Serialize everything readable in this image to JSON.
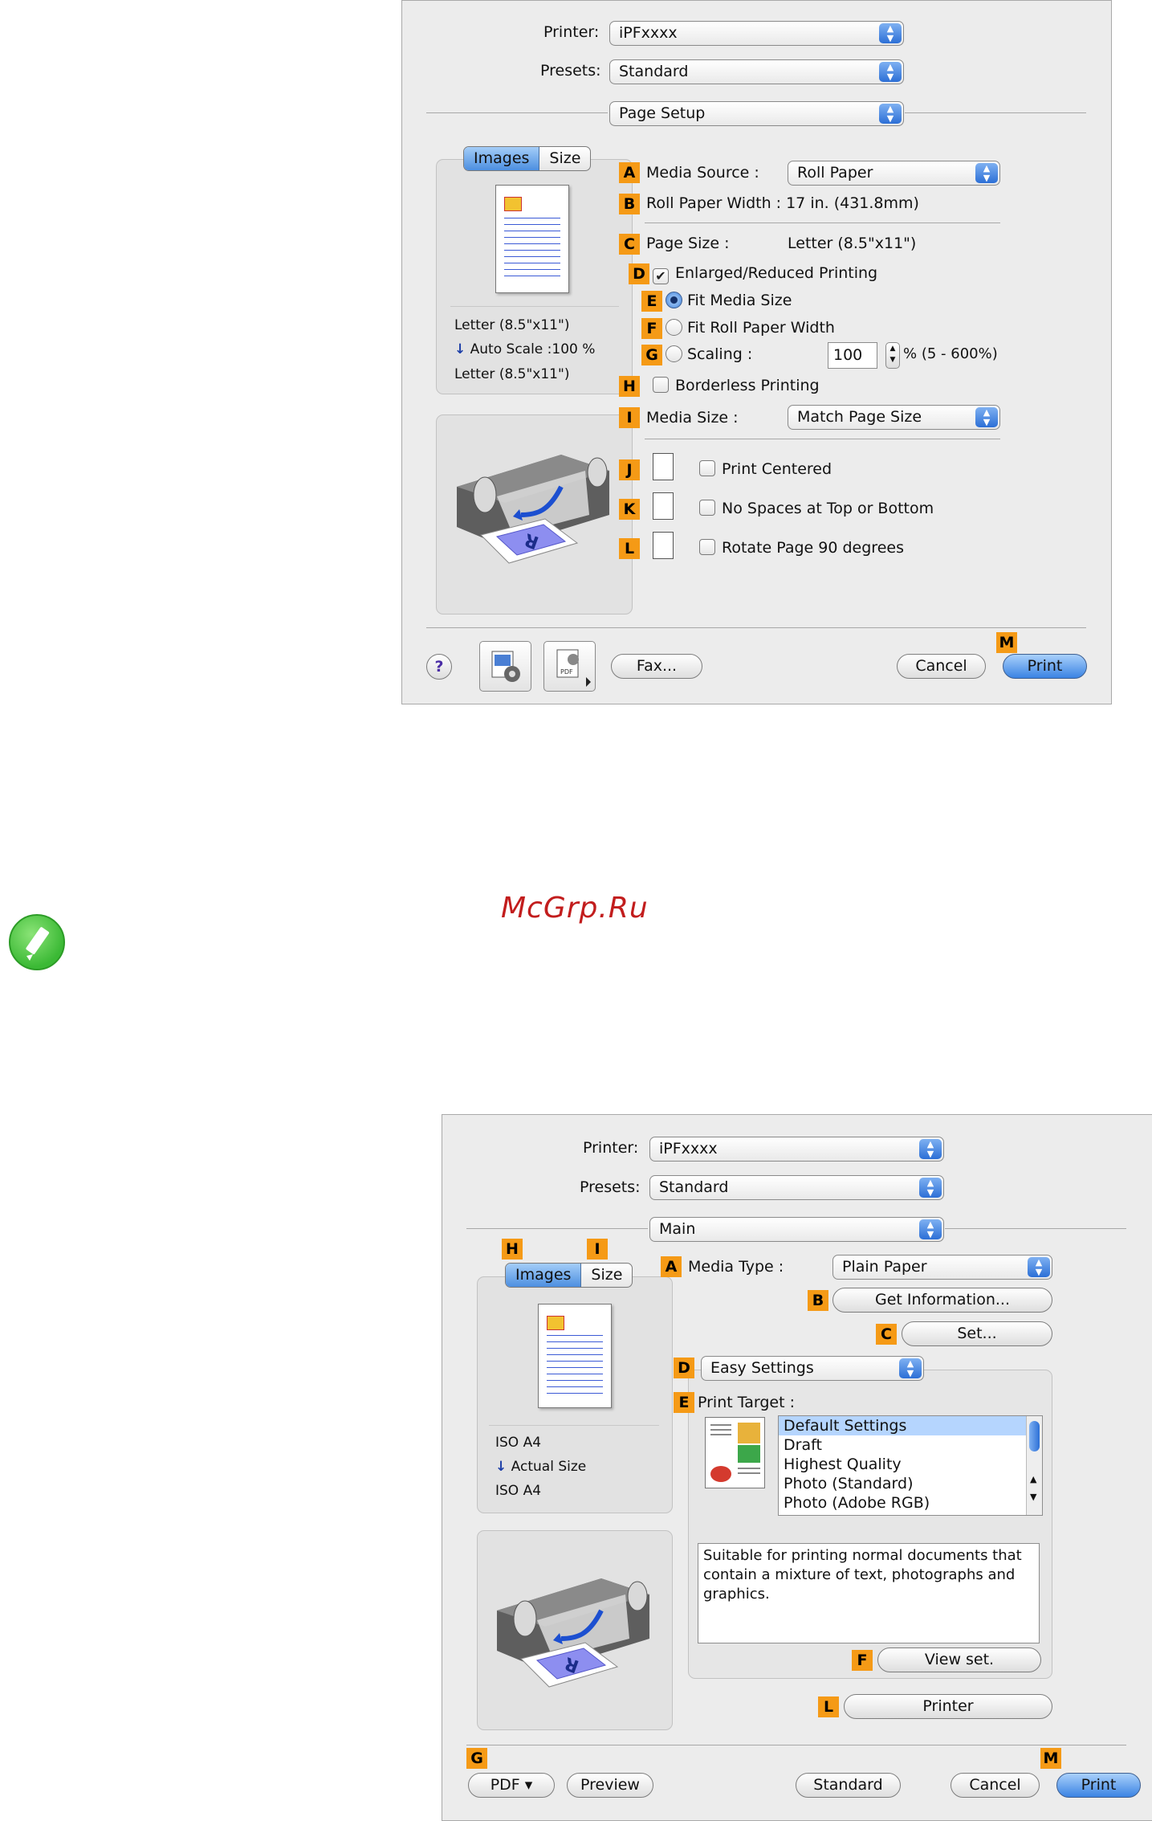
{
  "dialog1": {
    "printer_label": "Printer:",
    "printer_value": "iPFxxxx",
    "presets_label": "Presets:",
    "presets_value": "Standard",
    "panel_value": "Page Setup",
    "tabs": [
      "Images",
      "Size"
    ],
    "preview_lines": [
      "Letter (8.5\"x11\")",
      "Auto Scale :100 %",
      "Letter (8.5\"x11\")"
    ],
    "badges": [
      "A",
      "B",
      "C",
      "D",
      "E",
      "F",
      "G",
      "H",
      "I",
      "J",
      "K",
      "L",
      "M"
    ],
    "media_source_label": "Media Source :",
    "media_source_value": "Roll Paper",
    "roll_width_label": "Roll Paper Width : 17 in. (431.8mm)",
    "page_size_label": "Page Size :",
    "page_size_value": "Letter (8.5\"x11\")",
    "enlarged_label": "Enlarged/Reduced Printing",
    "fit_media_label": "Fit Media Size",
    "fit_roll_label": "Fit Roll Paper Width",
    "scaling_label": "Scaling :",
    "scaling_value": "100",
    "scaling_range": "% (5 - 600%)",
    "borderless_label": "Borderless Printing",
    "media_size_label": "Media Size :",
    "media_size_value": "Match Page Size",
    "print_centered_label": "Print Centered",
    "no_spaces_label": "No Spaces at Top or Bottom",
    "rotate_label": "Rotate Page 90 degrees",
    "help_label": "?",
    "fax_label": "Fax...",
    "cancel_label": "Cancel",
    "print_label": "Print"
  },
  "watermark": "McGrp.Ru",
  "dialog2": {
    "printer_label": "Printer:",
    "printer_value": "iPFxxxx",
    "presets_label": "Presets:",
    "presets_value": "Standard",
    "panel_value": "Main",
    "tabs": [
      "Images",
      "Size"
    ],
    "preview_lines": [
      "ISO A4",
      "Actual Size",
      "ISO A4"
    ],
    "badges": [
      "H",
      "I",
      "A",
      "B",
      "C",
      "D",
      "E",
      "F",
      "L",
      "G",
      "M"
    ],
    "media_type_label": "Media Type :",
    "media_type_value": "Plain Paper",
    "get_info_label": "Get Information...",
    "set_label": "Set...",
    "easy_settings_value": "Easy Settings",
    "print_target_label": "Print Target :",
    "print_target_items": [
      "Default Settings",
      "Draft",
      "Highest Quality",
      "Photo (Standard)",
      "Photo (Adobe RGB)"
    ],
    "description": "Suitable for printing normal documents that contain a mixture of text, photographs and graphics.",
    "view_set_label": "View set.",
    "printer_button_label": "Printer",
    "pdf_label": "PDF ▾",
    "preview_label": "Preview",
    "standard_label": "Standard",
    "cancel_label": "Cancel",
    "print_label": "Print"
  }
}
